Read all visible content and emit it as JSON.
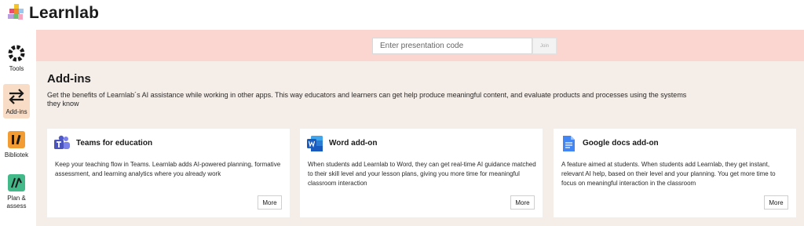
{
  "app": {
    "name": "Learnlab"
  },
  "sidebar": {
    "items": [
      {
        "label": "Tools",
        "icon": "tools-icon",
        "active": false
      },
      {
        "label": "Add-ins",
        "icon": "swap-arrows-icon",
        "active": true
      },
      {
        "label": "Bibliotek",
        "icon": "library-icon",
        "active": false
      },
      {
        "label": "Plan & assess",
        "icon": "plan-assess-icon",
        "active": false
      }
    ]
  },
  "search": {
    "placeholder": "Enter presentation code",
    "value": "",
    "join_label": "Join"
  },
  "main": {
    "title": "Add-ins",
    "description": "Get the benefits of Learnlab´s AI assistance while working in other apps. This way educators and learners can get help produce meaningful content, and evaluate products and processes using the systems they know"
  },
  "cards": [
    {
      "title": "Teams for education",
      "icon": "teams-icon",
      "description": "Keep your teaching flow in Teams. Learnlab adds AI-powered planning, formative assessment, and learning analytics where you already work",
      "button": "More"
    },
    {
      "title": "Word add-on",
      "icon": "word-icon",
      "description": "When students add Learnlab to Word, they can get real-time AI guidance matched to their skill level and your lesson plans, giving you more time for meaningful classroom interaction",
      "button": "More"
    },
    {
      "title": "Google docs add-on",
      "icon": "google-docs-icon",
      "description": "A feature aimed at students. When students add Learnlab, they get instant, relevant AI help, based on their level and your planning. You get more time to focus on meaningful interaction in the classroom",
      "button": "More"
    }
  ],
  "colors": {
    "search_band": "#fbd5cf",
    "main_background": "#f4ede8",
    "active_nav": "#f8dcc5",
    "library_icon": "#f39c34",
    "plan_icon": "#43b98a"
  }
}
